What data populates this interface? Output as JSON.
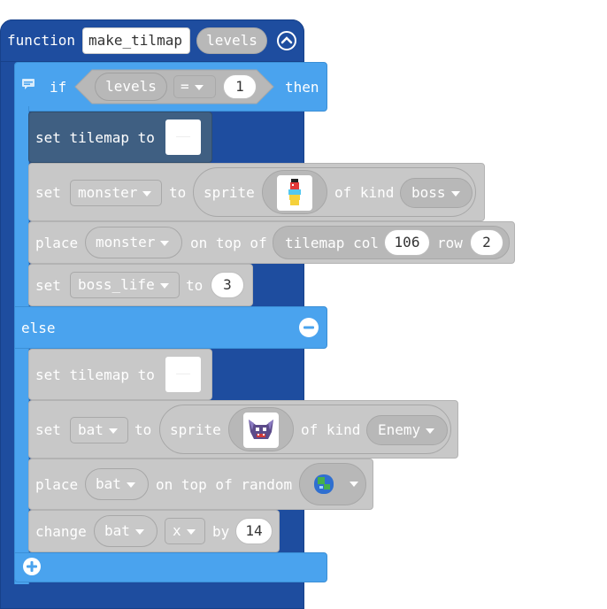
{
  "function": {
    "keyword": "function",
    "name": "make_tilmap",
    "param": "levels",
    "collapse_icon": "chevron-up-circle-icon"
  },
  "if_block": {
    "if_label": "if",
    "cond_left": "levels",
    "operator": "=",
    "cond_right": "1",
    "then_label": "then",
    "else_label": "else",
    "comment_icon": "comment-icon",
    "remove_icon": "minus-circle-icon",
    "add_icon": "plus-circle-icon"
  },
  "then_blocks": {
    "set_tilemap": {
      "label": "set tilemap to"
    },
    "set_monster": {
      "set": "set",
      "var": "monster",
      "to": "to",
      "sprite": "sprite",
      "of_kind": "of kind",
      "kind": "boss"
    },
    "place_monster": {
      "place": "place",
      "var": "monster",
      "on_top_of": "on top of",
      "tilemap_col": "tilemap col",
      "col": "106",
      "row_label": "row",
      "row": "2"
    },
    "set_boss_life": {
      "set": "set",
      "var": "boss_life",
      "to": "to",
      "value": "3"
    }
  },
  "else_blocks": {
    "set_tilemap": {
      "label": "set tilemap to"
    },
    "set_bat": {
      "set": "set",
      "var": "bat",
      "to": "to",
      "sprite": "sprite",
      "of_kind": "of kind",
      "kind": "Enemy"
    },
    "place_bat": {
      "place": "place",
      "var": "bat",
      "on_top_of_random": "on top of random"
    },
    "change_bat": {
      "change": "change",
      "var": "bat",
      "axis": "x",
      "by": "by",
      "value": "14"
    }
  },
  "colors": {
    "function": "#1e4d9f",
    "if": "#4aa3ee",
    "disabled": "#c8c8c8",
    "selected": "#3f5f82"
  }
}
